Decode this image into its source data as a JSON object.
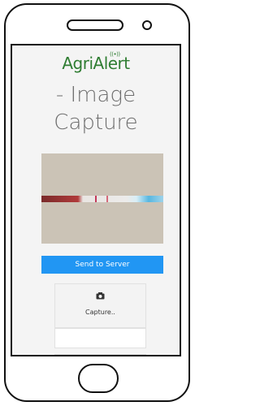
{
  "app": {
    "brand": "AgriAlert",
    "brand_icon": "wifi-signal-icon",
    "title": "- Image Capture"
  },
  "image_preview": {
    "subject": "test-strip"
  },
  "actions": {
    "send_label": "Send to Server",
    "capture_label": "Capture..",
    "capture_icon": "camera-icon"
  },
  "colors": {
    "brand": "#2f7d32",
    "primary_button": "#2196f3",
    "title_text": "#6e6e6e"
  }
}
